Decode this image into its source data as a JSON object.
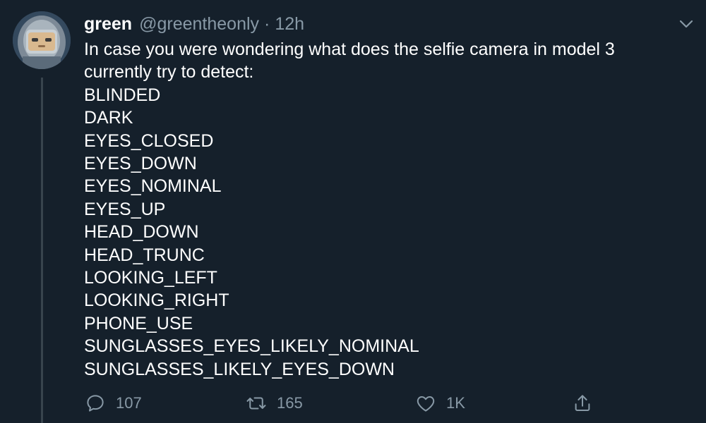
{
  "colors": {
    "background": "#15202b",
    "primary_text": "#ffffff",
    "secondary_text": "#8899a6",
    "thread_line": "#38444d"
  },
  "tweet": {
    "display_name": "green",
    "handle": "@greentheonly",
    "separator": "·",
    "time": "12h",
    "text_lines": [
      "In case you were wondering what does the selfie camera in model 3",
      "currently try to detect:",
      "BLINDED",
      "DARK",
      "EYES_CLOSED",
      "EYES_DOWN",
      "EYES_NOMINAL",
      "EYES_UP",
      "HEAD_DOWN",
      "HEAD_TRUNC",
      "LOOKING_LEFT",
      "LOOKING_RIGHT",
      "PHONE_USE",
      "SUNGLASSES_EYES_LIKELY_NOMINAL",
      "SUNGLASSES_LIKELY_EYES_DOWN"
    ]
  },
  "actions": {
    "reply": {
      "icon": "reply-icon",
      "count": "107"
    },
    "retweet": {
      "icon": "retweet-icon",
      "count": "165"
    },
    "like": {
      "icon": "heart-icon",
      "count": "1K"
    },
    "share": {
      "icon": "share-icon"
    }
  },
  "menu": {
    "icon": "chevron-down-icon"
  }
}
